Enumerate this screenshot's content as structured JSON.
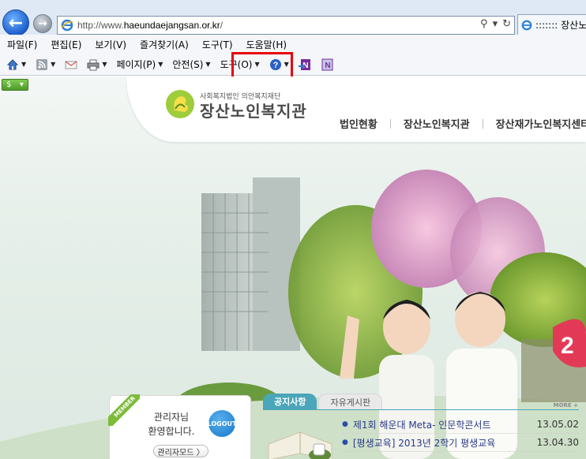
{
  "browser": {
    "address_url_prefix": "http://www.",
    "address_url_domain": "haeundaejangsan.or.kr",
    "address_url_suffix": "/",
    "tab_title": ":::::::  장산노",
    "menu": [
      "파일(F)",
      "편집(E)",
      "보기(V)",
      "즐겨찾기(A)",
      "도구(T)",
      "도움말(H)"
    ],
    "commands": {
      "page": "페이지(P)",
      "safety": "안전(S)",
      "tools": "도구(O)"
    },
    "status_chip": "$"
  },
  "site": {
    "logo_sub": "사회복지법인 의안복지재단",
    "logo_title": "장산노인복지관",
    "gnb": [
      "법인현황",
      "장산노인복지관",
      "장산재가노인복지센터"
    ],
    "banner_text": "2"
  },
  "member": {
    "ribbon": "MEMBER",
    "line1": "관리자님",
    "line2": "환영합니다.",
    "logout": "LOGOUT",
    "admin_mode": "관리자모드 〉"
  },
  "board": {
    "tabs": [
      "공지사항",
      "자유게시판"
    ],
    "more": "MORE +",
    "posts": [
      {
        "title": "제1회 해운대 Meta- 인문학콘서트",
        "date": "13.05.02"
      },
      {
        "title": "[평생교육] 2013년 2학기 평생교육",
        "date": "13.04.30"
      }
    ]
  },
  "colors": {
    "highlight": "#e8000b",
    "board_accent": "#4aa6b8",
    "post_title": "#2a3a8a"
  }
}
